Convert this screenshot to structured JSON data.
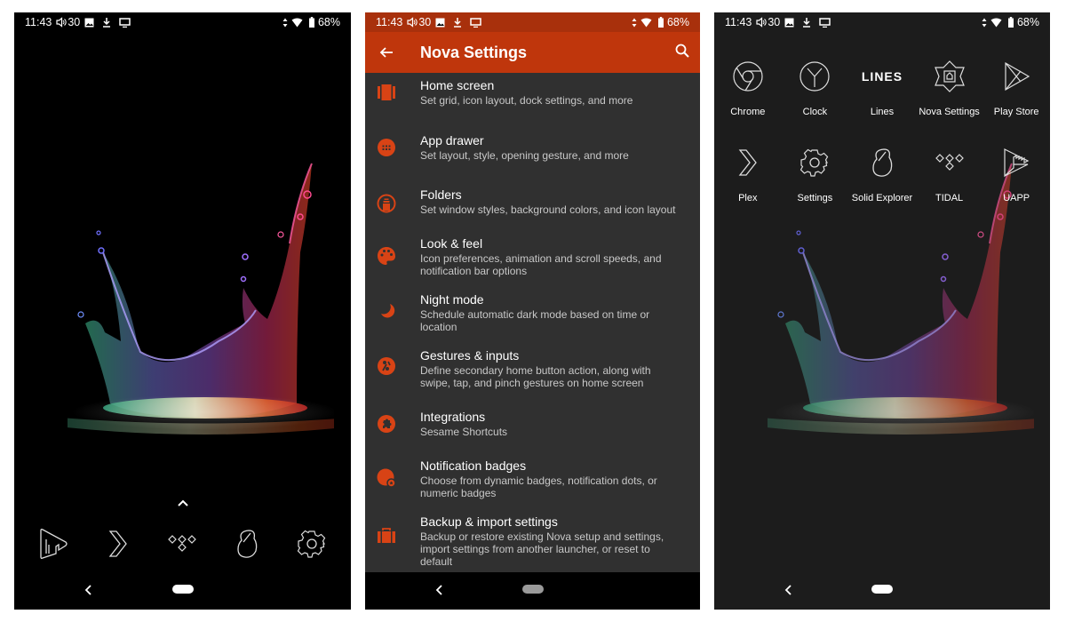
{
  "status_bar": {
    "time": "11:43",
    "volume_level": "30",
    "battery": "68%"
  },
  "colors": {
    "nova_accent": "#bf360c",
    "nova_statusbar": "#a8300c",
    "nova_background": "#303030",
    "drawer_background": "#1c1c1c"
  },
  "home_screen": {
    "dock": [
      {
        "name": "UAPP",
        "icon": "uapp-icon"
      },
      {
        "name": "Plex",
        "icon": "plex-icon"
      },
      {
        "name": "TIDAL",
        "icon": "tidal-icon"
      },
      {
        "name": "Solid Explorer",
        "icon": "solid-explorer-icon"
      },
      {
        "name": "Settings",
        "icon": "settings-icon"
      }
    ]
  },
  "nova_settings": {
    "title": "Nova Settings",
    "items": [
      {
        "title": "Home screen",
        "subtitle": "Set grid, icon layout, dock settings, and more",
        "icon": "home-screen-icon"
      },
      {
        "title": "App drawer",
        "subtitle": "Set layout, style, opening gesture, and more",
        "icon": "app-drawer-icon"
      },
      {
        "title": "Folders",
        "subtitle": "Set window styles, background colors, and icon layout",
        "icon": "folders-icon"
      },
      {
        "title": "Look & feel",
        "subtitle": "Icon preferences, animation and scroll speeds, and notification bar options",
        "icon": "palette-icon"
      },
      {
        "title": "Night mode",
        "subtitle": "Schedule automatic dark mode based on time or location",
        "icon": "moon-icon"
      },
      {
        "title": "Gestures & inputs",
        "subtitle": "Define secondary home button action, along with swipe, tap, and pinch gestures on home screen",
        "icon": "gesture-icon"
      },
      {
        "title": "Integrations",
        "subtitle": "Sesame Shortcuts",
        "icon": "puzzle-icon"
      },
      {
        "title": "Notification badges",
        "subtitle": "Choose from dynamic badges, notification dots, or numeric badges",
        "icon": "badge-icon"
      },
      {
        "title": "Backup & import settings",
        "subtitle": "Backup or restore existing Nova setup and settings, import settings from another launcher, or reset to default",
        "icon": "briefcase-icon"
      }
    ]
  },
  "app_drawer": {
    "apps": [
      {
        "name": "Chrome",
        "icon": "chrome-icon"
      },
      {
        "name": "Clock",
        "icon": "clock-icon"
      },
      {
        "name": "Lines",
        "icon": "lines-icon",
        "icon_text": "LINES"
      },
      {
        "name": "Nova Settings",
        "icon": "nova-settings-icon"
      },
      {
        "name": "Play Store",
        "icon": "play-store-icon"
      },
      {
        "name": "Plex",
        "icon": "plex-icon"
      },
      {
        "name": "Settings",
        "icon": "settings-icon"
      },
      {
        "name": "Solid Explorer",
        "icon": "solid-explorer-icon"
      },
      {
        "name": "TIDAL",
        "icon": "tidal-icon"
      },
      {
        "name": "UAPP",
        "icon": "uapp-icon"
      }
    ]
  }
}
